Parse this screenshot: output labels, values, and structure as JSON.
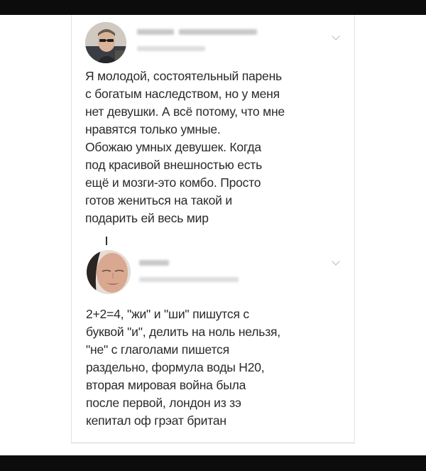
{
  "tweets": [
    {
      "avatar_icon": "person-sunglasses-avatar",
      "text": "Я молодой, состоятельный парень\nс богатым наследством, но у меня\nнет девушки. А всё потому, что мне\nнравятся только умные.\nОбожаю умных девушек. Когда\nпод красивой внешностью есть\nещё и мозги-это комбо. Просто\nготов жениться на такой и\nподарить ей весь мир"
    },
    {
      "avatar_icon": "woman-face-avatar",
      "text": "2+2=4, \"жи\" и \"ши\" пишутся с\nбуквой \"и\", делить на ноль нельзя,\n\"не\" с глаголами пишется\nраздельно, формула воды H20,\nвторая мировая война была\nпосле первой, лондон из зэ\nкепитал оф грэат британ"
    }
  ],
  "icons": {
    "menu": "chevron-down-icon"
  },
  "colors": {
    "frame": "#0c0c0c",
    "text": "#2a2a2a",
    "redacted": "#c9c9c9"
  }
}
